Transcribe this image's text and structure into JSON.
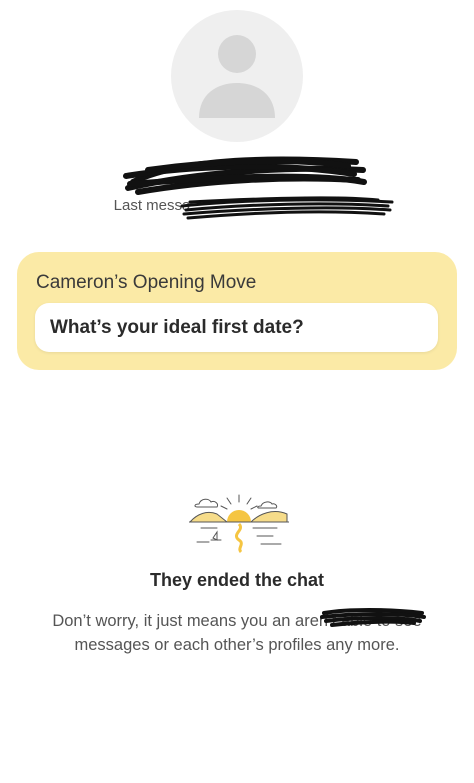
{
  "profile": {
    "avatar_icon": "user-avatar-placeholder-icon",
    "last_message_prefix": "Last messa"
  },
  "opening_move": {
    "title": "Cameron’s Opening Move",
    "question": "What’s your ideal first date?"
  },
  "ended": {
    "illustration_icon": "sunset-beach-illustration-icon",
    "title": "They ended the chat",
    "body": "Don’t worry, it just means you an aren’t able to see messages or each other’s profiles any more."
  },
  "colors": {
    "card_background": "#fbeaa6",
    "avatar_background": "#efefef",
    "illustration_accent": "#f5c542"
  }
}
